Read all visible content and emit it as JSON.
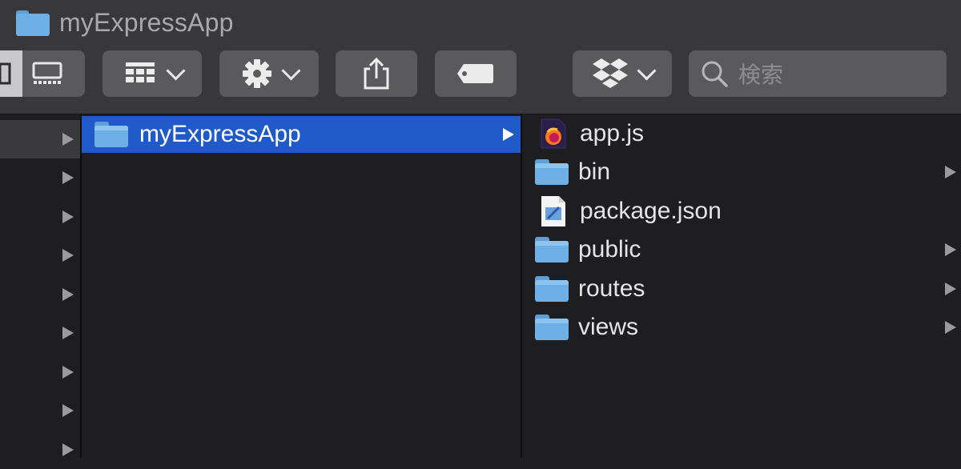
{
  "window": {
    "title": "myExpressApp"
  },
  "toolbar": {
    "view_mode": [
      "column",
      "gallery"
    ],
    "buttons": [
      {
        "name": "group-button",
        "icon": "grid-icon",
        "has_menu": true
      },
      {
        "name": "action-button",
        "icon": "gear-icon",
        "has_menu": true
      },
      {
        "name": "share-button",
        "icon": "share-icon",
        "has_menu": false
      },
      {
        "name": "tags-button",
        "icon": "tag-icon",
        "has_menu": false
      },
      {
        "name": "dropbox-button",
        "icon": "dropbox-icon",
        "has_menu": true
      }
    ],
    "search": {
      "placeholder": "検索"
    }
  },
  "columns": {
    "column1": {
      "rows": 9,
      "selected_index": 0
    },
    "column2": {
      "items": [
        {
          "label": "myExpressApp",
          "type": "folder",
          "selected": true
        }
      ]
    },
    "column3": {
      "items": [
        {
          "label": "app.js",
          "type": "js-file",
          "has_children": false
        },
        {
          "label": "bin",
          "type": "folder",
          "has_children": true
        },
        {
          "label": "package.json",
          "type": "json-file",
          "has_children": false
        },
        {
          "label": "public",
          "type": "folder",
          "has_children": true
        },
        {
          "label": "routes",
          "type": "folder",
          "has_children": true
        },
        {
          "label": "views",
          "type": "folder",
          "has_children": true
        }
      ]
    }
  },
  "colors": {
    "selection": "#1f5ac8",
    "folder": "#6eb0e6",
    "toolbar": "#38383a",
    "background": "#1e1e21"
  }
}
